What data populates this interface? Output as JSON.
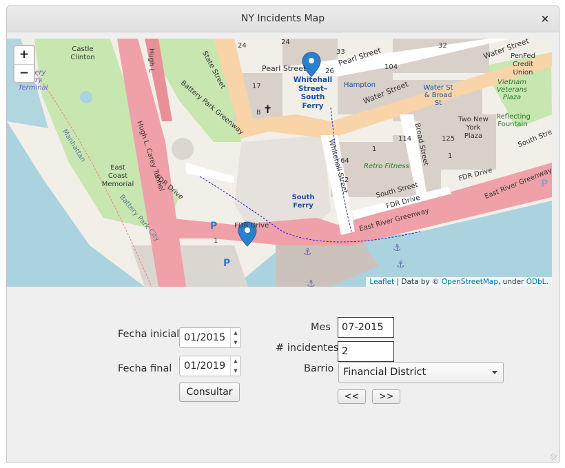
{
  "window": {
    "title": "NY Incidents Map",
    "close": "×"
  },
  "map": {
    "zoom_in": "+",
    "zoom_out": "−",
    "labels": {
      "pearl_street_1": "Pearl Street",
      "pearl_street_2": "Pearl Street",
      "water_street_1": "Water Street",
      "water_street_2": "Water Street",
      "whitehall_station": "Whitehall Street–South Ferry",
      "hampton": "Hampton",
      "water_broad": "Water St & Broad St",
      "two_ny_plaza": "Two New York Plaza",
      "penfed": "PenFed Credit Union",
      "vietnam": "Vietnam Veterans Plaza",
      "reflecting": "Reflecting Fountain",
      "castle_clinton": "Castle Clinton",
      "battery_ferry": "Battery Ferry Terminal",
      "state_street": "State Street",
      "battery_park_greenway": "Battery Park Greenway",
      "hugh_carey_tunnel": "Hugh L. Carey Tunnel",
      "east_coast_memorial": "East Coast Memorial",
      "fdr_drive_1": "FDR Drive",
      "fdr_drive_2": "FDR Drive",
      "fdr_drive_3": "FDR Drive",
      "fdr_drive_4": "FDR Drive",
      "south_street_1": "South Street",
      "south_street_2": "South Street",
      "east_river_greenway_1": "East River Greenway",
      "east_river_greenway_2": "East River Greenway",
      "south_ferry": "South Ferry",
      "whitehall_street": "Whitehall Street",
      "broad_street": "Broad Street",
      "retro_fitness": "Retro Fitness",
      "manhattan": "Manhattan",
      "battery_park_city": "Battery Park City",
      "hugh_l_vert": "Hugh L"
    },
    "numbers": {
      "n24a": "24",
      "n24b": "24",
      "n33": "33",
      "n26": "26",
      "n104": "104",
      "n32": "32",
      "n17": "17",
      "n8": "8",
      "n1a": "1",
      "n1b": "1",
      "n114": "114",
      "n125": "125",
      "n64": "64",
      "n2": "2",
      "n1c": "1"
    },
    "attribution": {
      "leaflet": "Leaflet",
      "data": "| Data by ©",
      "osm": "OpenStreetMap",
      "under": ", under",
      "odbl": "ODbL",
      "end": "."
    }
  },
  "form": {
    "fecha_inicial_label": "Fecha inicial",
    "fecha_inicial_value": "01/2015",
    "fecha_final_label": "Fecha final",
    "fecha_final_value": "01/2019",
    "consultar": "Consultar",
    "mes_label": "Mes",
    "mes_value": "07-2015",
    "incidentes_label": "# incidentes",
    "incidentes_value": "2",
    "barrio_label": "Barrio",
    "barrio_value": "Financial District",
    "prev": "<<",
    "next": ">>"
  },
  "colors": {
    "water": "#aad3df",
    "park": "#c8e6b0",
    "road_major": "#f0a0a8",
    "road_secondary": "#f8d4a8",
    "building": "#d9d0c9",
    "marker": "#2a81cb"
  }
}
